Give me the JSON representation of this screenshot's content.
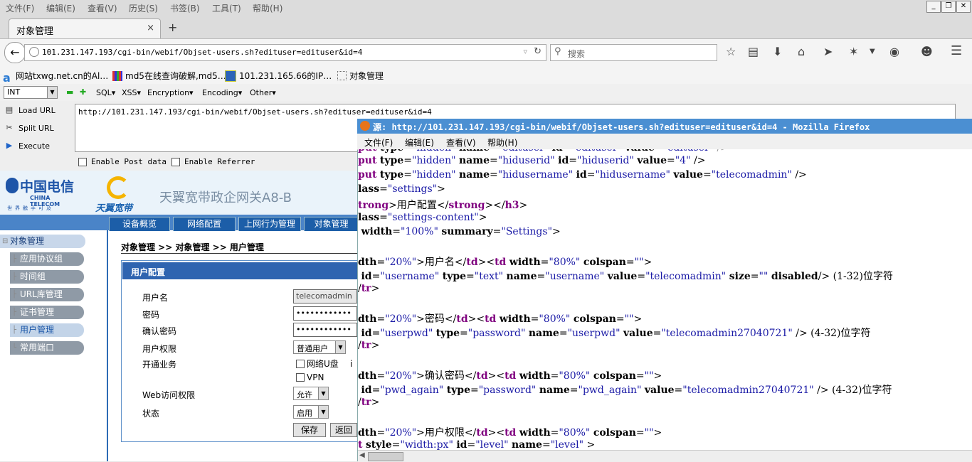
{
  "menubar": [
    "文件(F)",
    "编辑(E)",
    "查看(V)",
    "历史(S)",
    "书签(B)",
    "工具(T)",
    "帮助(H)"
  ],
  "window_buttons": [
    "_",
    "❐",
    "✕"
  ],
  "tab": {
    "title": "对象管理",
    "close": "×",
    "new": "+"
  },
  "nav": {
    "url": "101.231.147.193/cgi-bin/webif/Objset-users.sh?edituser=edituser&id=4",
    "search_placeholder": "搜索"
  },
  "bookmarks": [
    "网站txwg.net.cn的Al…",
    "md5在线查询破解,md5…",
    "101.231.165.66的IP…",
    "对象管理"
  ],
  "hackbar": {
    "select": "INT",
    "menus": [
      "SQL▾",
      "XSS▾",
      "Encryption▾",
      "Encoding▾",
      "Other▾"
    ],
    "buttons": [
      "Load URL",
      "Split URL",
      "Execute"
    ],
    "url": "http://101.231.147.193/cgi-bin/webif/Objset-users.sh?edituser=edituser&id=4",
    "checks": [
      "Enable Post data",
      "Enable Referrer"
    ]
  },
  "router": {
    "brand_cn": "中国电信",
    "brand_en": "CHINA TELECOM",
    "slogan": "世界触手可及",
    "tianyi": "天翼宽带",
    "title": "天翼宽带政企网关A8-B",
    "tabs": [
      "设备概览",
      "网络配置",
      "上网行为管理",
      "对象管理"
    ],
    "sidebar": [
      "对象管理",
      "应用协议组",
      "时间组",
      "URL库管理",
      "证书管理",
      "用户管理",
      "常用端口"
    ],
    "breadcrumb": "对象管理 >> 对象管理 >> 用户管理",
    "form_title": "用户配置",
    "labels": [
      "用户名",
      "密码",
      "确认密码",
      "用户权限",
      "开通业务",
      "Web访问权限",
      "状态"
    ],
    "username": "telecomadmin",
    "password_mask": "••••••••••••",
    "confirm_mask": "••••••••••••",
    "permission": "普通用户",
    "service1": "网络U盘",
    "service1_extra": "i",
    "service2": "VPN",
    "web_access": "允许",
    "status": "启用",
    "save": "保存",
    "back": "返回"
  },
  "source": {
    "title": "源: http://101.231.147.193/cgi-bin/webif/Objset-users.sh?edituser=edituser&id=4 - Mozilla Firefox",
    "menu": [
      "文件(F)",
      "编辑(E)",
      "查看(V)",
      "帮助(H)"
    ]
  }
}
